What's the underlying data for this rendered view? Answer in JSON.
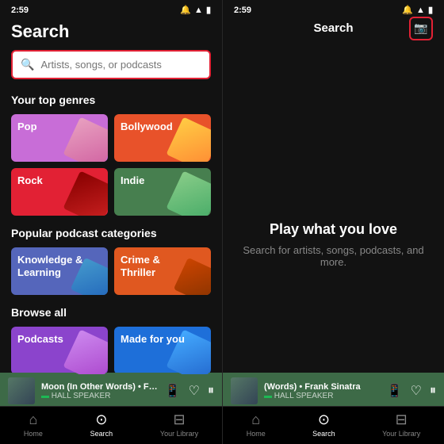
{
  "left": {
    "status": {
      "time": "2:59",
      "icons": [
        "notch",
        "wifi",
        "battery"
      ]
    },
    "title": "Search",
    "search": {
      "placeholder": "Artists, songs, or podcasts"
    },
    "top_genres": {
      "label": "Your top genres",
      "items": [
        {
          "name": "Pop",
          "color": "#c86dd7",
          "type": "pop"
        },
        {
          "name": "Bollywood",
          "color": "#e8522a",
          "type": "bollywood"
        },
        {
          "name": "Rock",
          "color": "#e22134",
          "type": "rock"
        },
        {
          "name": "Indie",
          "color": "#477f4f",
          "type": "indie"
        }
      ]
    },
    "podcast_categories": {
      "label": "Popular podcast categories",
      "items": [
        {
          "name": "Knowledge &\nLearning",
          "color": "#5566bb",
          "type": "knowledge"
        },
        {
          "name": "Crime &\nThriller",
          "color": "#e05820",
          "type": "crime"
        }
      ]
    },
    "browse": {
      "label": "Browse all",
      "items": [
        {
          "name": "Podcasts",
          "color": "#8b44cc",
          "type": "podcasts"
        },
        {
          "name": "Made for you",
          "color": "#1e6fd9",
          "type": "madeforyou"
        }
      ]
    },
    "now_playing": {
      "title": "Moon (In Other Words) • Frank",
      "subtitle": "HALL SPEAKER"
    },
    "nav": [
      {
        "label": "Home",
        "icon": "⌂",
        "active": false
      },
      {
        "label": "Search",
        "icon": "⊙",
        "active": true
      },
      {
        "label": "Your Library",
        "icon": "⊟",
        "active": false
      }
    ]
  },
  "right": {
    "status": {
      "time": "2:59",
      "icons": [
        "notch",
        "wifi",
        "battery"
      ]
    },
    "header": {
      "title": "Search",
      "camera_label": "📷"
    },
    "body": {
      "title": "Play what you love",
      "subtitle": "Search for artists, songs, podcasts, and more."
    },
    "now_playing": {
      "title": "(Words) • Frank Sinatra",
      "subtitle": "HALL SPEAKER"
    },
    "nav": [
      {
        "label": "Home",
        "icon": "⌂",
        "active": false
      },
      {
        "label": "Search",
        "icon": "⊙",
        "active": true
      },
      {
        "label": "Your Library",
        "icon": "⊟",
        "active": false
      }
    ]
  }
}
